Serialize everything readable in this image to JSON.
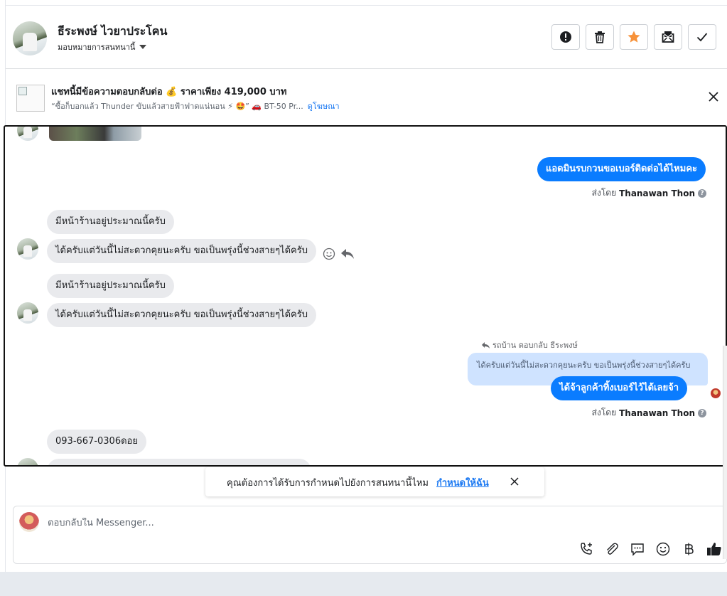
{
  "header": {
    "name": "ธีระพงษ์ ไวยาประโคน",
    "assign_label": "มอบหมายการสนทนานี้",
    "actions": [
      "report",
      "delete",
      "star",
      "mark-unread",
      "done"
    ],
    "star_color": "#f7923a"
  },
  "ad": {
    "title": "แชทนี้มีข้อความตอบกลับต่อ 💰 ราคาเพียง 419,000 บาท",
    "subtitle": "“ซื้อก็บอกแล้ว Thunder ขับแล้วสายฟ้าฟาดแน่นอน ⚡ 🤩” 🚗 BT-50 Pr...",
    "link": "ดูโฆษณา"
  },
  "chat": {
    "messages": [
      {
        "dir": "out",
        "text": "แอดมินรบกวนขอเบอร์ติดต่อได้ไหมคะ",
        "sent_by_prefix": "ส่งโดย",
        "sent_by": "Thanawan Thon"
      },
      {
        "dir": "in",
        "text": "มีหน้าร้านอยู่ประมาณนี้ครับ"
      },
      {
        "dir": "in",
        "text": "ได้ครับแต่วันนี้ไม่สะดวกคุยนะครับ ขอเป็นพรุ่งนี้ช่วงสายๆได้ครับ"
      },
      {
        "dir": "in",
        "text": "มีหน้าร้านอยู่ประมาณนี้ครับ"
      },
      {
        "dir": "in",
        "text": "ได้ครับแต่วันนี้ไม่สะดวกคุยนะครับ ขอเป็นพรุ่งนี้ช่วงสายๆได้ครับ"
      },
      {
        "dir": "out",
        "reply_note": "รถบ้าน ตอบกลับ ธีระพงษ์",
        "quoted": "ได้ครับแต่วันนี้ไม่สะดวกคุยนะครับ ขอเป็นพรุ่งนี้ช่วงสายๆได้ครับ",
        "text": "ได้จ้าลูกค้าทิ้งเบอร์ไว้ได้เลยจ้า",
        "sent_by_prefix": "ส่งโดย",
        "sent_by": "Thanawan Thon"
      },
      {
        "dir": "in",
        "text": "093-667-0306ดอย"
      }
    ],
    "accent": "#0a7cff"
  },
  "notice": {
    "text": "คุณต้องการได้รับการกำหนดไปยังการสนทนานี้ไหม",
    "link": "กำหนดให้ฉัน"
  },
  "composer": {
    "placeholder": "ตอบกลับใน Messenger...",
    "tools": [
      "call-add-icon",
      "attachment-icon",
      "saved-reply-icon",
      "emoji-icon",
      "baht-icon",
      "thumbs-up-icon"
    ]
  }
}
